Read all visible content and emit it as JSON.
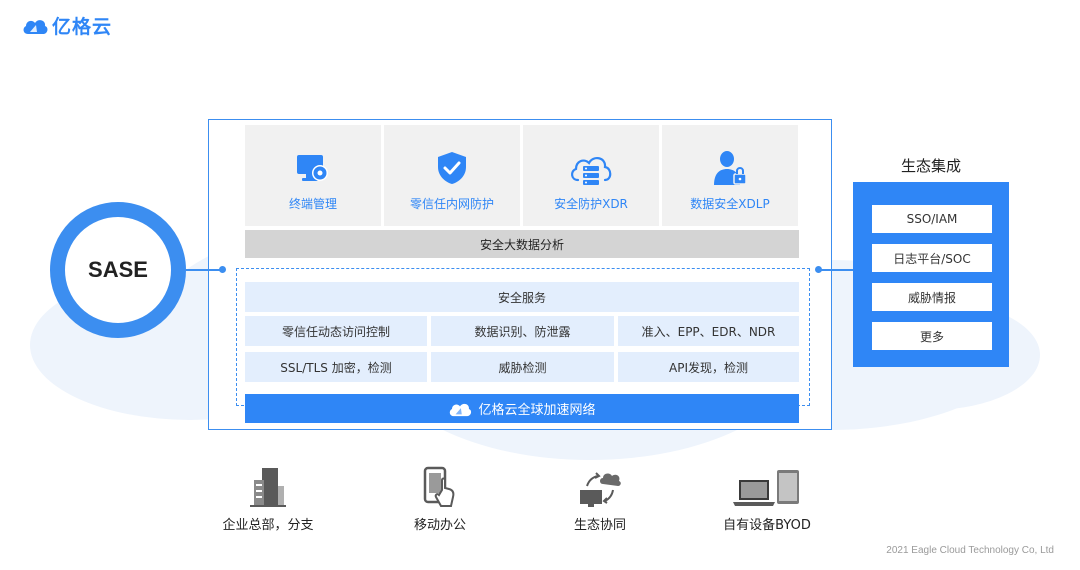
{
  "brand": {
    "name": "亿格云"
  },
  "modules": [
    {
      "label": "终端管理",
      "icon": "device-management-icon"
    },
    {
      "label": "零信任内网防护",
      "icon": "shield-check-icon"
    },
    {
      "label": "安全防护XDR",
      "icon": "cloud-server-icon"
    },
    {
      "label": "数据安全XDLP",
      "icon": "user-lock-icon"
    }
  ],
  "big_data": "安全大数据分析",
  "security_services": {
    "title": "安全服务",
    "rows": [
      [
        "零信任动态访问控制",
        "数据识别、防泄露",
        "准入、EPP、EDR、NDR"
      ],
      [
        "SSL/TLS 加密，检测",
        "威胁检测",
        "API发现，检测"
      ]
    ]
  },
  "network": "亿格云全球加速网络",
  "sase": "SASE",
  "ecosystem": {
    "title": "生态集成",
    "items": [
      "SSO/IAM",
      "日志平台/SOC",
      "威胁情报",
      "更多"
    ]
  },
  "endpoints": [
    {
      "label": "企业总部，分支",
      "icon": "building-icon"
    },
    {
      "label": "移动办公",
      "icon": "mobile-touch-icon"
    },
    {
      "label": "生态协同",
      "icon": "cloud-sync-icon"
    },
    {
      "label": "自有设备BYOD",
      "icon": "laptop-tablet-icon"
    }
  ],
  "footer": "2021 Eagle Cloud Technology Co, Ltd",
  "colors": {
    "accent": "#2f86f6",
    "panel_light": "#e3eefd",
    "panel_gray": "#f1f1f1"
  }
}
